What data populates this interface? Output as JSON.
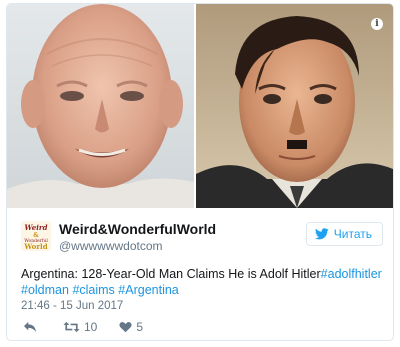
{
  "tweet": {
    "author": {
      "display_name": "Weird&WonderfulWorld",
      "handle": "@wwwwwwdotcom",
      "avatar_text": [
        "Weird",
        "&",
        "Wonderful",
        "World"
      ]
    },
    "follow_button": {
      "label": "Читать",
      "icon": "twitter-bird-icon"
    },
    "text": {
      "plain": "Argentina: 128-Year-Old Man Claims He is Adolf Hitler",
      "hashtags": [
        "#adolfhitler",
        "#oldman",
        "#claims",
        "#Argentina"
      ]
    },
    "timestamp": "21:46 - 15 Jun 2017",
    "actions": {
      "reply": {
        "icon": "reply-icon"
      },
      "retweet": {
        "icon": "retweet-icon",
        "count": "10"
      },
      "like": {
        "icon": "heart-icon",
        "count": "5"
      }
    },
    "media": {
      "info_icon_label": "i",
      "photos": [
        "elderly-man-photo",
        "historical-portrait-photo"
      ]
    }
  },
  "colors": {
    "link": "#1b95e0",
    "follow_blue": "#1da1f2",
    "muted": "#657786",
    "text": "#14171a",
    "border": "#e1e8ed"
  }
}
